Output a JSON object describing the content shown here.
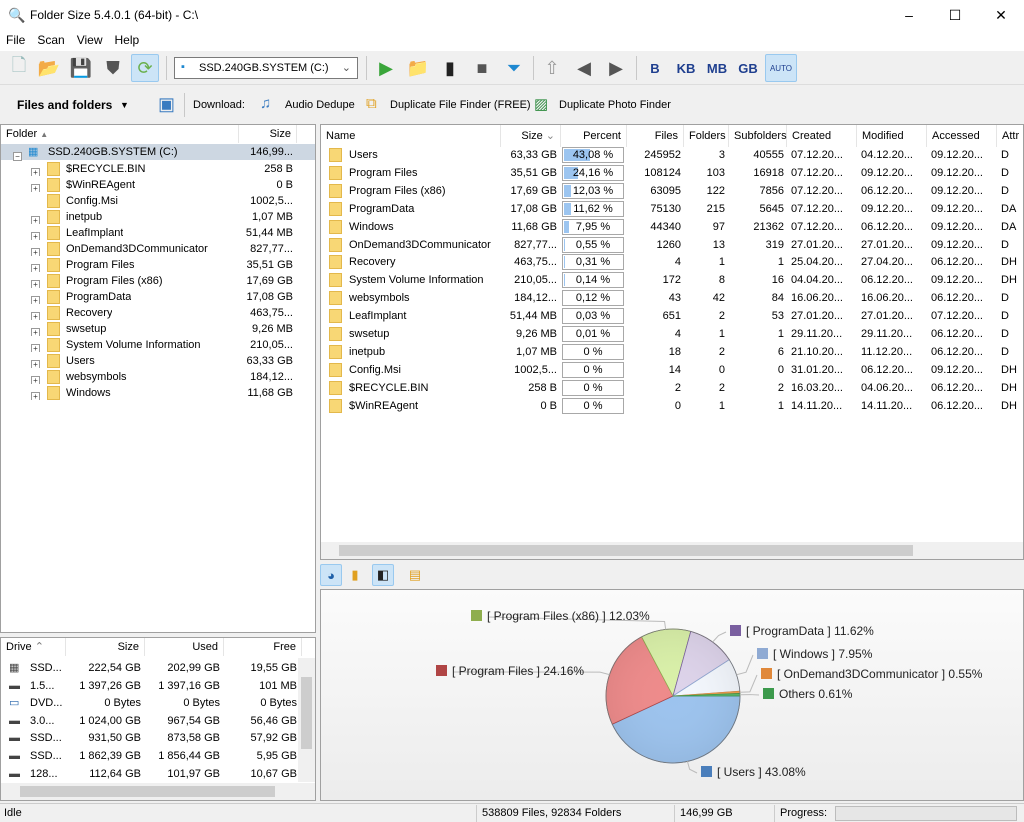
{
  "window": {
    "title": "Folder Size 5.4.0.1 (64-bit) - C:\\",
    "min": "–",
    "max": "☐",
    "close": "✕"
  },
  "menu": [
    "File",
    "Scan",
    "View",
    "Help"
  ],
  "toolbar": {
    "drive_select": "SSD.240GB.SYSTEM (C:)",
    "units": [
      "B",
      "KB",
      "MB",
      "GB",
      "AUTO"
    ]
  },
  "toolbar2": {
    "view_mode": "Files and folders",
    "download_label": "Download:",
    "links": [
      "Audio Dedupe",
      "Duplicate File Finder (FREE)",
      "Duplicate Photo Finder"
    ]
  },
  "tree": {
    "headers": [
      "Folder",
      "Size"
    ],
    "root": {
      "name": "SSD.240GB.SYSTEM (C:)",
      "size": "146,99..."
    },
    "items": [
      [
        "$RECYCLE.BIN",
        "258 B",
        true
      ],
      [
        "$WinREAgent",
        "0 B",
        true
      ],
      [
        "Config.Msi",
        "1002,5...",
        false
      ],
      [
        "inetpub",
        "1,07 MB",
        true
      ],
      [
        "LeafImplant",
        "51,44 MB",
        true
      ],
      [
        "OnDemand3DCommunicator",
        "827,77...",
        true
      ],
      [
        "Program Files",
        "35,51 GB",
        true
      ],
      [
        "Program Files (x86)",
        "17,69 GB",
        true
      ],
      [
        "ProgramData",
        "17,08 GB",
        true
      ],
      [
        "Recovery",
        "463,75...",
        true
      ],
      [
        "swsetup",
        "9,26 MB",
        true
      ],
      [
        "System Volume Information",
        "210,05...",
        true
      ],
      [
        "Users",
        "63,33 GB",
        true
      ],
      [
        "websymbols",
        "184,12...",
        true
      ],
      [
        "Windows",
        "11,68 GB",
        true
      ]
    ]
  },
  "list": {
    "headers": [
      "Name",
      "Size",
      "Percent",
      "Files",
      "Folders",
      "Subfolders",
      "Created",
      "Modified",
      "Accessed",
      "Attr"
    ],
    "rows": [
      [
        "Users",
        "63,33 GB",
        "43,08 %",
        43.08,
        "245952",
        "3",
        "40555",
        "07.12.20...",
        "04.12.20...",
        "09.12.20...",
        "D"
      ],
      [
        "Program Files",
        "35,51 GB",
        "24,16 %",
        24.16,
        "108124",
        "103",
        "16918",
        "07.12.20...",
        "09.12.20...",
        "09.12.20...",
        "D"
      ],
      [
        "Program Files (x86)",
        "17,69 GB",
        "12,03 %",
        12.03,
        "63095",
        "122",
        "7856",
        "07.12.20...",
        "06.12.20...",
        "09.12.20...",
        "D"
      ],
      [
        "ProgramData",
        "17,08 GB",
        "11,62 %",
        11.62,
        "75130",
        "215",
        "5645",
        "07.12.20...",
        "09.12.20...",
        "09.12.20...",
        "DA"
      ],
      [
        "Windows",
        "11,68 GB",
        "7,95 %",
        7.95,
        "44340",
        "97",
        "21362",
        "07.12.20...",
        "06.12.20...",
        "09.12.20...",
        "DA"
      ],
      [
        "OnDemand3DCommunicator",
        "827,77...",
        "0,55 %",
        0.55,
        "1260",
        "13",
        "319",
        "27.01.20...",
        "27.01.20...",
        "09.12.20...",
        "D"
      ],
      [
        "Recovery",
        "463,75...",
        "0,31 %",
        0.31,
        "4",
        "1",
        "1",
        "25.04.20...",
        "27.04.20...",
        "06.12.20...",
        "DH"
      ],
      [
        "System Volume Information",
        "210,05...",
        "0,14 %",
        0.14,
        "172",
        "8",
        "16",
        "04.04.20...",
        "06.12.20...",
        "09.12.20...",
        "DH"
      ],
      [
        "websymbols",
        "184,12...",
        "0,12 %",
        0.12,
        "43",
        "42",
        "84",
        "16.06.20...",
        "16.06.20...",
        "06.12.20...",
        "D"
      ],
      [
        "LeafImplant",
        "51,44 MB",
        "0,03 %",
        0.03,
        "651",
        "2",
        "53",
        "27.01.20...",
        "27.01.20...",
        "07.12.20...",
        "D"
      ],
      [
        "swsetup",
        "9,26 MB",
        "0,01 %",
        0.01,
        "4",
        "1",
        "1",
        "29.11.20...",
        "29.11.20...",
        "06.12.20...",
        "D"
      ],
      [
        "inetpub",
        "1,07 MB",
        "0 %",
        0,
        "18",
        "2",
        "6",
        "21.10.20...",
        "11.12.20...",
        "06.12.20...",
        "D"
      ],
      [
        "Config.Msi",
        "1002,5...",
        "0 %",
        0,
        "14",
        "0",
        "0",
        "31.01.20...",
        "06.12.20...",
        "09.12.20...",
        "DH"
      ],
      [
        "$RECYCLE.BIN",
        "258 B",
        "0 %",
        0,
        "2",
        "2",
        "2",
        "16.03.20...",
        "04.06.20...",
        "06.12.20...",
        "DH"
      ],
      [
        "$WinREAgent",
        "0 B",
        "0 %",
        0,
        "0",
        "1",
        "1",
        "14.11.20...",
        "14.11.20...",
        "06.12.20...",
        "DH"
      ]
    ]
  },
  "drives": {
    "headers": [
      "Drive",
      "Size",
      "Used",
      "Free"
    ],
    "rows": [
      [
        "SSD...",
        "222,54 GB",
        "202,99 GB",
        "19,55 GB"
      ],
      [
        "1.5...",
        "1 397,26 GB",
        "1 397,16 GB",
        "101 MB"
      ],
      [
        "DVD...",
        "0 Bytes",
        "0 Bytes",
        "0 Bytes"
      ],
      [
        "3.0...",
        "1 024,00 GB",
        "967,54 GB",
        "56,46 GB"
      ],
      [
        "SSD...",
        "931,50 GB",
        "873,58 GB",
        "57,92 GB"
      ],
      [
        "SSD...",
        "1 862,39 GB",
        "1 856,44 GB",
        "5,95 GB"
      ],
      [
        "128...",
        "112,64 GB",
        "101,97 GB",
        "10,67 GB"
      ]
    ]
  },
  "chart_data": {
    "type": "pie",
    "series": [
      {
        "label": "[ Users ] 43.08%",
        "value": 43.08,
        "color": "#4a7ebb",
        "fill": "#9cc3ee"
      },
      {
        "label": "[ Program Files ] 24.16%",
        "value": 24.16,
        "color": "#b04545",
        "fill": "#ee8a8a"
      },
      {
        "label": "[ Program Files (x86) ] 12.03%",
        "value": 12.03,
        "color": "#8fae4e",
        "fill": "#d9f0a8"
      },
      {
        "label": "[ ProgramData ] 11.62%",
        "value": 11.62,
        "color": "#7a5fa0",
        "fill": "#ddd3ea"
      },
      {
        "label": "[ Windows ] 7.95%",
        "value": 7.95,
        "color": "#8faad3",
        "fill": "#f3f7fd"
      },
      {
        "label": "[ OnDemand3DCommunicator ] 0.55%",
        "value": 0.55,
        "color": "#e0883a",
        "fill": "#f0a050"
      },
      {
        "label": "Others 0.61%",
        "value": 0.61,
        "color": "#3c9a4c",
        "fill": "#5cba6c"
      }
    ]
  },
  "status": {
    "state": "Idle",
    "counts": "538809 Files, 92834 Folders",
    "total": "146,99 GB",
    "progress_label": "Progress:",
    "progress": 0
  }
}
